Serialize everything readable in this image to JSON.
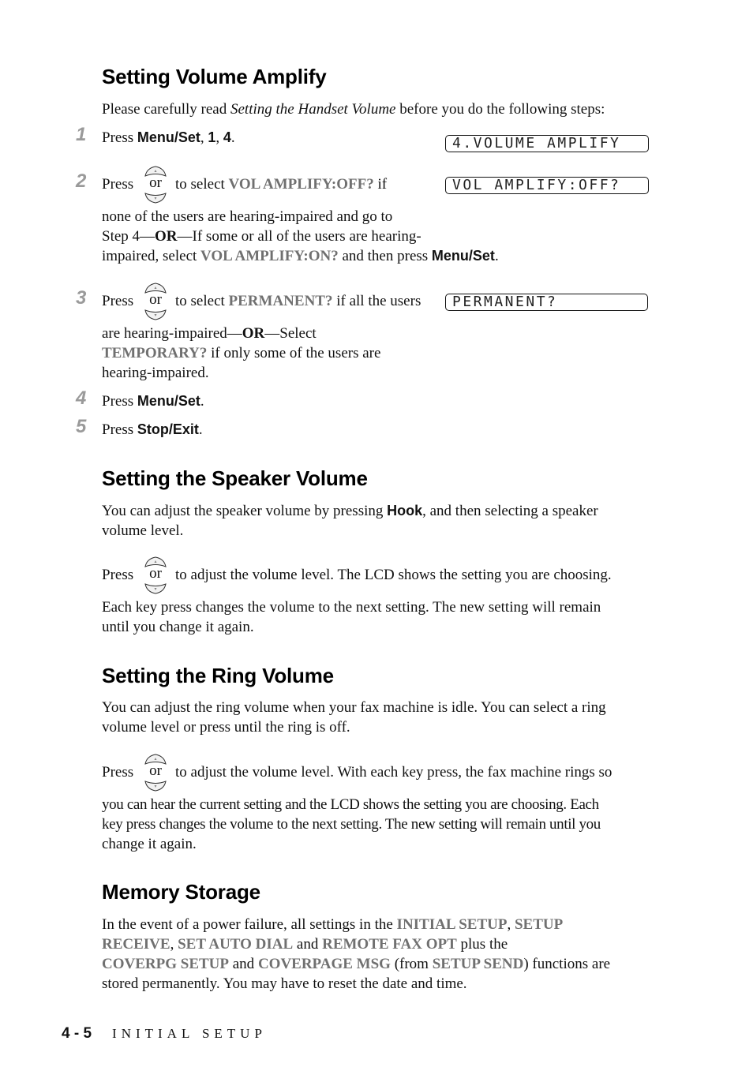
{
  "sections": {
    "volume_amplify": {
      "title": "Setting Volume Amplify",
      "intro": {
        "pre": "Please carefully read ",
        "ref": "Setting the Handset Volume",
        "post": " before you do the following steps:"
      },
      "steps": [
        {
          "num": "1",
          "press": "Press ",
          "key": "Menu/Set",
          "sep1": ", ",
          "k1": "1",
          "sep2": ", ",
          "k2": "4",
          "end": ".",
          "lcd": "4.VOLUME AMPLIFY"
        },
        {
          "num": "2",
          "press": "Press",
          "or": "or",
          "t1": "to select ",
          "menu1": "VOL AMPLIFY:OFF?",
          "t2": " if",
          "line2": "none of the users are hearing-impaired and go to",
          "line3_pre": "Step 4—",
          "line3_or": "OR",
          "line3_post": "—If some or all of the users are hearing-",
          "line4_pre": "impaired, select ",
          "menu2": "VOL AMPLIFY:ON?",
          "line4_mid": " and then press ",
          "key": "Menu/Set",
          "end": ".",
          "lcd": "VOL AMPLIFY:OFF?"
        },
        {
          "num": "3",
          "press": "Press",
          "or": "or",
          "t1": "to select ",
          "menu1": "PERMANENT?",
          "t2": " if all the users",
          "line2_pre": "are hearing-impaired—",
          "line2_or": "OR",
          "line2_post": "—Select",
          "menu2": "TEMPORARY?",
          "line3_post": " if only some of the users are",
          "line4": "hearing-impaired.",
          "lcd": "PERMANENT?"
        },
        {
          "num": "4",
          "press": "Press ",
          "key": "Menu/Set",
          "end": "."
        },
        {
          "num": "5",
          "press": "Press ",
          "key": "Stop/Exit",
          "end": "."
        }
      ]
    },
    "speaker_volume": {
      "title": "Setting the Speaker Volume",
      "p1_pre": "You can adjust the speaker volume by pressing ",
      "p1_key": "Hook",
      "p1_post": ", and then selecting a speaker",
      "p1_line2": "volume level.",
      "press": "Press",
      "or": "or",
      "p2": "to adjust the volume level. The LCD shows the setting you are choosing.",
      "p3_line1": "Each key press changes the volume to the next setting. The new setting will remain",
      "p3_line2": "until you change it again."
    },
    "ring_volume": {
      "title": "Setting the Ring Volume",
      "p1_line1": "You can adjust the ring volume when your fax machine is idle. You can select a ring",
      "p1_line2": "volume level or press until the ring is off.",
      "press": "Press",
      "or": "or",
      "p2": "to adjust the volume level. With each key press, the fax machine rings so",
      "p3_line1": "you can hear the current setting and the LCD shows the setting you are choosing. Each",
      "p3_line2": "key press changes the volume to the next setting. The new setting will remain until you",
      "p3_line3": "change it again."
    },
    "memory_storage": {
      "title": "Memory Storage",
      "l1_pre": "In the event of a power failure, all settings in the ",
      "m1": "INITIAL SETUP",
      "l1_sep": ", ",
      "m2a": "SETUP",
      "m2b": "RECEIVE",
      "l2_sep": ", ",
      "m3": "SET AUTO DIAL",
      "l2_and": " and ",
      "m4": "REMOTE FAX OPT",
      "l2_post": " plus the",
      "m5": "COVERPG SETUP",
      "l3_and": " and ",
      "m6": "COVERPAGE MSG",
      "l3_from": " (from ",
      "m7": "SETUP SEND",
      "l3_post": ") functions are",
      "l4": "stored permanently. You may have to reset the date and time."
    }
  },
  "footer": {
    "page_number": "4 - 5",
    "chapter": "INITIAL SETUP"
  },
  "colors": {
    "menu_text": "#707070",
    "step_number": "#9a9a9a"
  }
}
